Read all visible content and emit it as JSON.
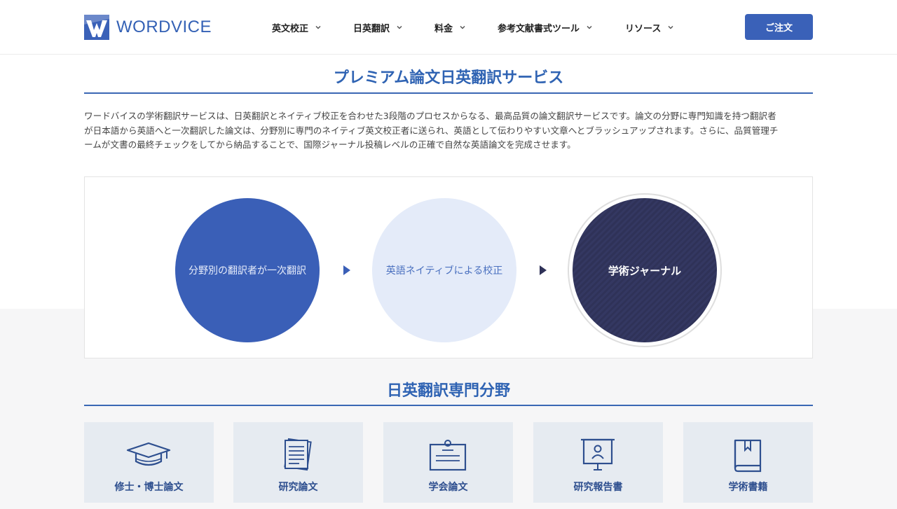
{
  "header": {
    "logo_text": "WORDVICE",
    "nav": [
      {
        "label": "英文校正"
      },
      {
        "label": "日英翻訳"
      },
      {
        "label": "料金"
      },
      {
        "label": "参考文献書式ツール"
      },
      {
        "label": "リソース"
      }
    ],
    "order_label": "ご注文"
  },
  "main": {
    "title": "プレミアム論文日英翻訳サービス",
    "intro_lines": [
      "ワードバイスの学術翻訳サービスは、日英翻訳とネイティブ校正を合わせた3段階のプロセスからなる、最高品質の論文翻訳サービスです。論文の分野に専門知識を持つ翻訳者",
      "が日本語から英語へと一次翻訳した論文は、分野別に専門のネイティブ英文校正者に送られ、英語として伝わりやすい文章へとブラッシュアップされます。さらに、品質管理チ",
      "ームが文書の最終チェックをしてから納品することで、国際ジャーナル投稿レベルの正確で自然な英語論文を完成させます。"
    ],
    "process": {
      "steps": [
        {
          "label": "分野別の翻訳者が一次翻訳"
        },
        {
          "label": "英語ネイティブによる校正"
        },
        {
          "label": "学術ジャーナル"
        }
      ]
    },
    "fields_title": "日英翻訳専門分野",
    "fields": [
      {
        "label": "修士・博士論文",
        "icon": "graduation-cap-icon"
      },
      {
        "label": "研究論文",
        "icon": "document-stack-icon"
      },
      {
        "label": "学会論文",
        "icon": "certificate-icon"
      },
      {
        "label": "研究報告書",
        "icon": "presentation-board-icon"
      },
      {
        "label": "学術書籍",
        "icon": "book-icon"
      }
    ]
  },
  "colors": {
    "brand_blue": "#3a61b8",
    "title_blue": "#2f63b3",
    "dark_navy": "#2f3258",
    "light_blue": "#e4ebf9",
    "card_bg": "#e6ebf1"
  }
}
